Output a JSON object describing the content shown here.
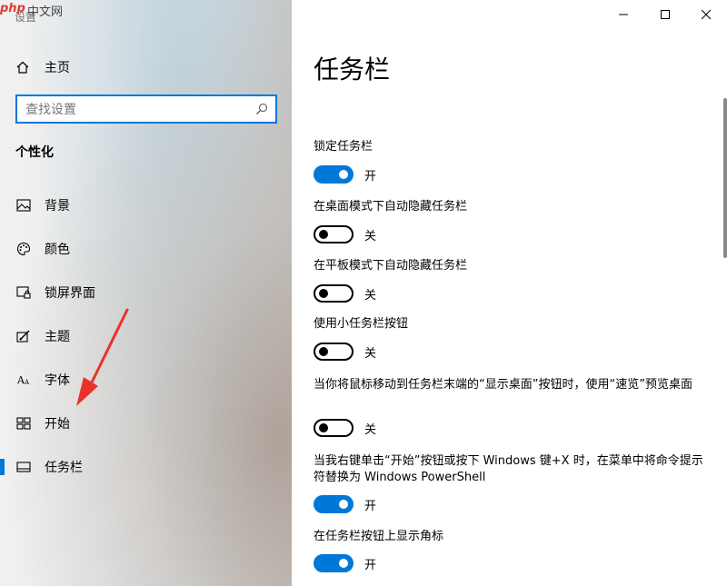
{
  "window": {
    "app_title": "设置",
    "watermark_php": "php",
    "watermark_cn": "中文网"
  },
  "sidebar": {
    "home_label": "主页",
    "search_placeholder": "查找设置",
    "section_title": "个性化",
    "items": [
      {
        "label": "背景",
        "icon": "image-icon"
      },
      {
        "label": "颜色",
        "icon": "palette-icon"
      },
      {
        "label": "锁屏界面",
        "icon": "lock-screen-icon"
      },
      {
        "label": "主题",
        "icon": "theme-brush-icon"
      },
      {
        "label": "字体",
        "icon": "font-icon"
      },
      {
        "label": "开始",
        "icon": "start-tiles-icon"
      },
      {
        "label": "任务栏",
        "icon": "taskbar-icon",
        "active": true
      }
    ]
  },
  "main": {
    "title": "任务栏",
    "settings": [
      {
        "label": "锁定任务栏",
        "state": "开",
        "on": true
      },
      {
        "label": "在桌面模式下自动隐藏任务栏",
        "state": "关",
        "on": false
      },
      {
        "label": "在平板模式下自动隐藏任务栏",
        "state": "关",
        "on": false
      },
      {
        "label": "使用小任务栏按钮",
        "state": "关",
        "on": false
      },
      {
        "label": "当你将鼠标移动到任务栏末端的“显示桌面”按钮时，使用“速览”预览桌面",
        "state": "关",
        "on": false
      },
      {
        "label": "当我右键单击“开始”按钮或按下 Windows 键+X 时，在菜单中将命令提示符替换为 Windows PowerShell",
        "state": "开",
        "on": true
      },
      {
        "label": "在任务栏按钮上显示角标",
        "state": "开",
        "on": true
      }
    ]
  },
  "colors": {
    "accent": "#0078d7",
    "annotation_arrow": "#e8332a"
  }
}
